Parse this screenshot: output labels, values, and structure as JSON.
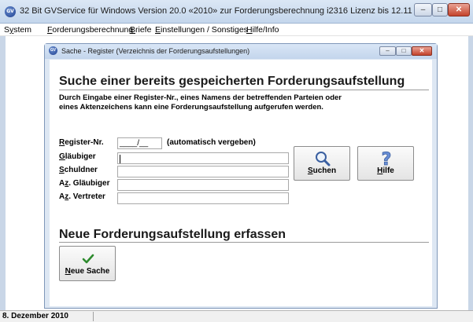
{
  "app": {
    "icon_text": "GV",
    "title": "32 Bit GVService für Windows Version 20.0 «2010» zur Forderungsberechnung i2316 Lizenz bis 12.11"
  },
  "window_controls": {
    "minimize": "–",
    "maximize": "□",
    "close": "✕"
  },
  "menu": [
    {
      "label": "System",
      "accel": "y"
    },
    {
      "label": "Forderungsberechnung",
      "accel": "F"
    },
    {
      "label": "Briefe",
      "accel": "B"
    },
    {
      "label": "Einstellungen / Sonstiges",
      "accel": "E"
    },
    {
      "label": "Hilfe/Info",
      "accel": "H"
    }
  ],
  "dialog": {
    "title": "Sache - Register (Verzeichnis der Forderungsaufstellungen)",
    "heading": "Suche einer bereits gespeicherten Forderungsaufstellung",
    "description_line1": "Durch Eingabe einer Register-Nr., eines Namens der betreffenden Parteien oder",
    "description_line2": "eines Aktenzeichens kann eine Forderungsaufstellung aufgerufen werden.",
    "fields": {
      "register_nr": {
        "label_pre": "",
        "label_accel": "R",
        "label_post": "egister-Nr.",
        "value": "____/__",
        "note": "(automatisch vergeben)"
      },
      "glaeubiger": {
        "label_pre": "",
        "label_accel": "G",
        "label_post": "läubiger",
        "value": ""
      },
      "schuldner": {
        "label_pre": "",
        "label_accel": "S",
        "label_post": "chuldner",
        "value": ""
      },
      "az_glaeubiger": {
        "label_pre": "A",
        "label_accel": "z",
        "label_post": ". Gläubiger",
        "value": ""
      },
      "az_vertreter": {
        "label_pre": "A",
        "label_accel": "z",
        "label_post": ". Vertreter",
        "value": ""
      }
    },
    "search_button": {
      "accel": "S",
      "rest": "uchen",
      "icon": "magnifier-icon"
    },
    "help_button": {
      "accel": "H",
      "rest": "ilfe",
      "icon": "question-mark-icon"
    },
    "new_heading": "Neue Forderungsaufstellung erfassen",
    "new_button": {
      "accel": "N",
      "rest": "eue Sache",
      "icon": "checkmark-icon"
    }
  },
  "status": {
    "date": "8. Dezember 2010"
  }
}
